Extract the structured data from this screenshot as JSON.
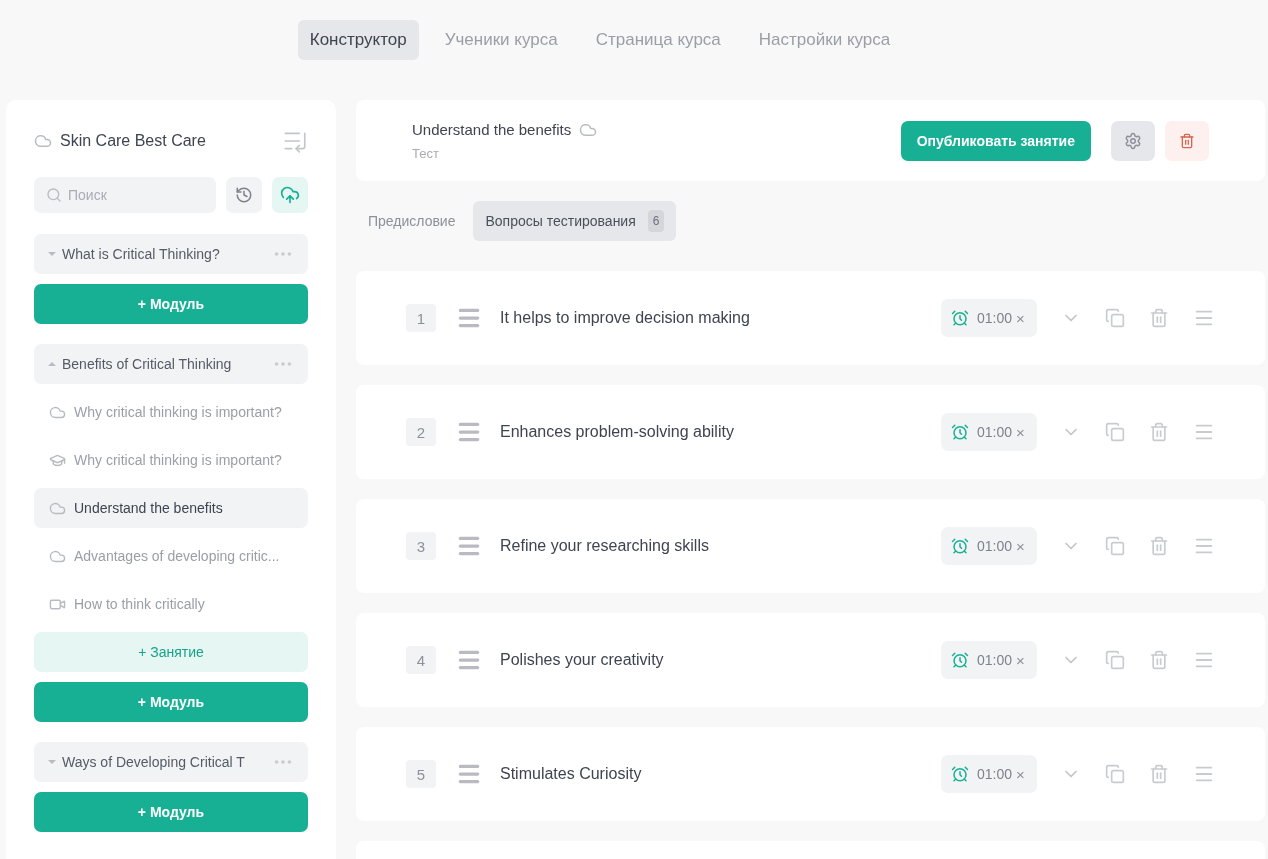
{
  "top_tabs": [
    {
      "label": "Конструктор",
      "selected": true
    },
    {
      "label": "Ученики курса",
      "selected": false
    },
    {
      "label": "Страница курса",
      "selected": false
    },
    {
      "label": "Настройки курса",
      "selected": false
    }
  ],
  "sidebar": {
    "course_title": "Skin Care Best Care",
    "search": {
      "placeholder": "Поиск"
    },
    "modules": [
      {
        "title": "What is Critical Thinking?",
        "expanded": false,
        "add_module": "+ Модуль"
      },
      {
        "title": "Benefits of Critical Thinking",
        "expanded": true,
        "lessons": [
          {
            "kind": "text",
            "title": "Why critical thinking is important?",
            "selected": false
          },
          {
            "kind": "test",
            "title": "Why critical thinking is important?",
            "selected": false
          },
          {
            "kind": "text",
            "title": "Understand the benefits",
            "selected": true
          },
          {
            "kind": "text",
            "title": "Advantages of developing critic...",
            "selected": false
          },
          {
            "kind": "video",
            "title": "How to think critically",
            "selected": false
          }
        ],
        "add_lesson": "+ Занятие",
        "add_module": "+ Модуль"
      },
      {
        "title": "Ways of Developing Critical T",
        "expanded": false,
        "add_module": "+ Модуль"
      }
    ]
  },
  "lesson": {
    "title": "Understand the benefits",
    "type": "Тест",
    "publish_button": "Опубликовать занятие"
  },
  "sub_tabs": [
    {
      "label": "Предисловие",
      "selected": false
    },
    {
      "label": "Вопросы тестирования",
      "count": "6",
      "selected": true
    }
  ],
  "questions": [
    {
      "number": "1",
      "text": "It helps to improve decision making",
      "time": "01:00",
      "clear": "×"
    },
    {
      "number": "2",
      "text": "Enhances problem-solving ability",
      "time": "01:00",
      "clear": "×"
    },
    {
      "number": "3",
      "text": "Refine your researching skills",
      "time": "01:00",
      "clear": "×"
    },
    {
      "number": "4",
      "text": "Polishes your creativity",
      "time": "01:00",
      "clear": "×"
    },
    {
      "number": "5",
      "text": "Stimulates Curiosity",
      "time": "01:00",
      "clear": "×"
    }
  ]
}
